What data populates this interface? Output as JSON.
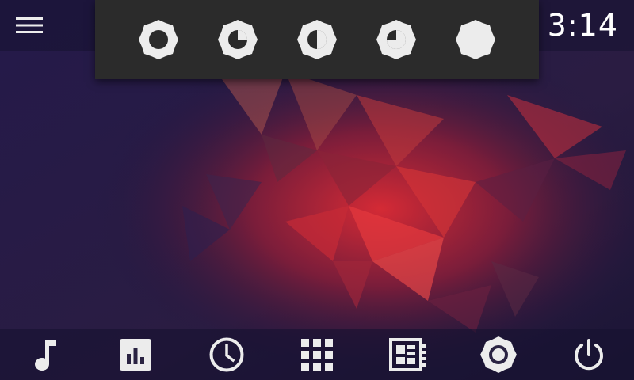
{
  "status_bar": {
    "time": "3:14",
    "menu_icon": "menu-icon"
  },
  "brightness_panel": {
    "levels": [
      {
        "icon": "brightness-low-icon",
        "level": 0
      },
      {
        "icon": "brightness-quarter-icon",
        "level": 0.25
      },
      {
        "icon": "brightness-half-icon",
        "level": 0.5
      },
      {
        "icon": "brightness-three-quarter-icon",
        "level": 0.75
      },
      {
        "icon": "brightness-full-icon",
        "level": 1
      }
    ]
  },
  "dock": {
    "items": [
      {
        "icon": "music-note-icon"
      },
      {
        "icon": "equalizer-icon"
      },
      {
        "icon": "clock-icon"
      },
      {
        "icon": "app-grid-icon"
      },
      {
        "icon": "dashboard-icon"
      },
      {
        "icon": "brightness-icon"
      },
      {
        "icon": "power-icon"
      }
    ]
  },
  "colors": {
    "background": "#1e1740",
    "panel": "#2b2b2b",
    "icon": "#ececec",
    "accent": "#e2303c"
  }
}
